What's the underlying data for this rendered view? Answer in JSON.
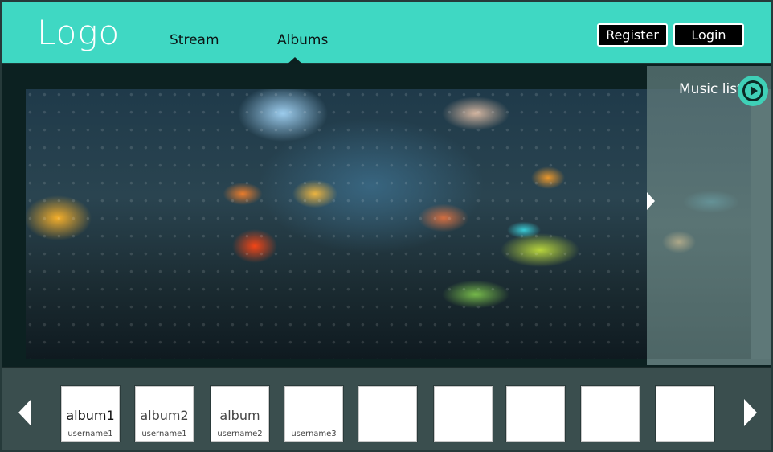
{
  "header": {
    "logo": "Logo",
    "nav": [
      {
        "label": "Stream"
      },
      {
        "label": "Albums"
      }
    ],
    "register_label": "Register",
    "login_label": "Login"
  },
  "main": {
    "music_list_label": "Music list"
  },
  "albums": [
    {
      "title": "album1",
      "user": "username1"
    },
    {
      "title": "album2",
      "user": "username1"
    },
    {
      "title": "album",
      "user": "username2"
    },
    {
      "title": "",
      "user": "username3"
    },
    {
      "title": "",
      "user": ""
    },
    {
      "title": "",
      "user": ""
    },
    {
      "title": "",
      "user": ""
    },
    {
      "title": "",
      "user": ""
    },
    {
      "title": "",
      "user": ""
    }
  ],
  "colors": {
    "accent": "#3fd8c3",
    "dark": "#0c2121",
    "strip": "#3a4e4e"
  }
}
